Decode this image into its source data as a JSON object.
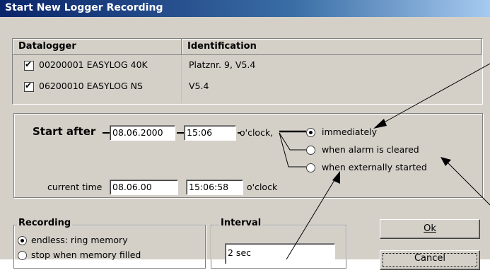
{
  "window": {
    "title": "Start New Logger Recording"
  },
  "list": {
    "columns": [
      "Datalogger",
      "Identification"
    ],
    "rows": [
      {
        "checked": true,
        "datalogger": "00200001 EASYLOG 40K",
        "identification": "Platznr. 9, V5.4"
      },
      {
        "checked": true,
        "datalogger": "06200010 EASYLOG NS",
        "identification": "V5.4"
      }
    ]
  },
  "start": {
    "label": "Start after",
    "date": "08.06.2000",
    "time": "15:06",
    "oclock_label": "o'clock,",
    "options": [
      {
        "label": "immediately",
        "selected": true
      },
      {
        "label": "when alarm is cleared",
        "selected": false
      },
      {
        "label": "when externally started",
        "selected": false
      }
    ],
    "current_label": "current time",
    "current_date": "08.06.00",
    "current_time": "15:06:58",
    "current_suffix": "o'clock"
  },
  "recording": {
    "title": "Recording",
    "options": [
      {
        "label": "endless: ring memory",
        "selected": true
      },
      {
        "label": "stop when memory filled",
        "selected": false
      }
    ]
  },
  "interval": {
    "title": "Interval",
    "value": "2 sec"
  },
  "buttons": {
    "ok": "Ok",
    "cancel": "Cancel"
  }
}
